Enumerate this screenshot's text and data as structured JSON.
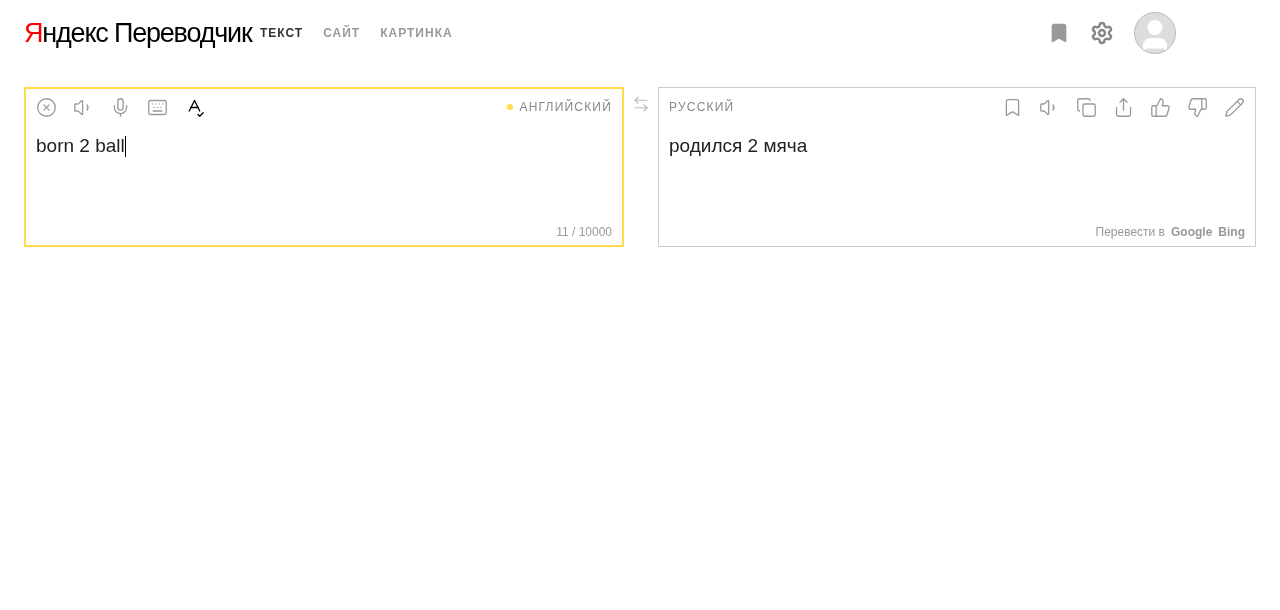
{
  "header": {
    "logo": {
      "brand_initial": "Я",
      "brand_rest": "ндекс",
      "product": "Переводчик"
    },
    "tabs": [
      {
        "label": "ТЕКСТ",
        "selected": true
      },
      {
        "label": "САЙТ",
        "selected": false
      },
      {
        "label": "КАРТИНКА",
        "selected": false
      }
    ]
  },
  "source": {
    "language": "АНГЛИЙСКИЙ",
    "detected": true,
    "value": "born 2 ball",
    "counter": "11 / 10000",
    "focused": true
  },
  "target": {
    "language": "РУССКИЙ",
    "text": "родился 2 мяча",
    "footer_label": "Перевести в",
    "engines": [
      "Google",
      "Bing"
    ]
  }
}
